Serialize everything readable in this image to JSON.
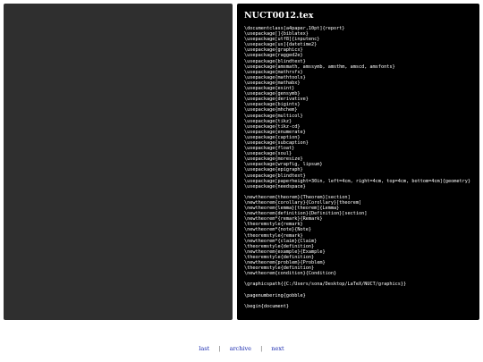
{
  "document": {
    "title": "NUCT0012.tex",
    "lines": [
      "\\documentclass[a4paper,10pt]{report}",
      "\\usepackage[]{biblatex}",
      "\\usepackage[utf8]{inputenc}",
      "\\usepackage[us]{datetime2}",
      "\\usepackage{graphicx}",
      "\\usepackage{ragged2e}",
      "\\usepackage{blindtext}",
      "\\usepackage{amsmath, amssymb, amsthm, amscd, amsfonts}",
      "\\usepackage{mathrsfs}",
      "\\usepackage{mathtools}",
      "\\usepackage{mathabx}",
      "\\usepackage{esint}",
      "\\usepackage{gensymb}",
      "\\usepackage{derivative}",
      "\\usepackage{bigints}",
      "\\usepackage{mhchem}",
      "\\usepackage{multicol}",
      "\\usepackage{tikz}",
      "\\usepackage{tikz-cd}",
      "\\usepackage{enumerate}",
      "\\usepackage{caption}",
      "\\usepackage{subcaption}",
      "\\usepackage{float}",
      "\\usepackage{soul}",
      "\\usepackage{moresize}",
      "\\usepackage{wrapfig, lipsum}",
      "\\usepackage{epigraph}",
      "\\usepackage{blindtext}",
      "\\usepackage[paperheight=30in, left=4cm, right=4cm, top=4cm, bottom=4cm]{geometry}",
      "\\usepackage{needspace}",
      "",
      "\\newtheorem{theorem}{Theorem}[section]",
      "\\newtheorem{corollary}{Corollary}[theorem]",
      "\\newtheorem{lemma}[theorem]{Lemma}",
      "\\newtheorem{definition}{Definition}[section]",
      "\\newtheorem*{remark}{Remark}",
      "\\theoremstyle{remark}",
      "\\newtheorem*{note}{Note}",
      "\\theoremstyle{remark}",
      "\\newtheorem*{claim}{Claim}",
      "\\theoremstyle{definition}",
      "\\newtheorem{example}{Example}",
      "\\theoremstyle{definition}",
      "\\newtheorem{problem}{Problem}",
      "\\theoremstyle{definition}",
      "\\newtheorem{condition}{Condition}",
      "",
      "\\graphicspath{{C:/Users/sona/Desktop/LaTeX/NUCT/graphics}}",
      "",
      "\\pagenumbering{gobble}",
      "",
      "\\begin{document}"
    ]
  },
  "nav": {
    "last": "last",
    "archive": "archive",
    "next": "next",
    "separator": "|"
  },
  "colors": {
    "left_panel": "#2f2f2f",
    "right_panel": "#000000",
    "text": "#ffffff",
    "link": "#1a2bb0"
  }
}
